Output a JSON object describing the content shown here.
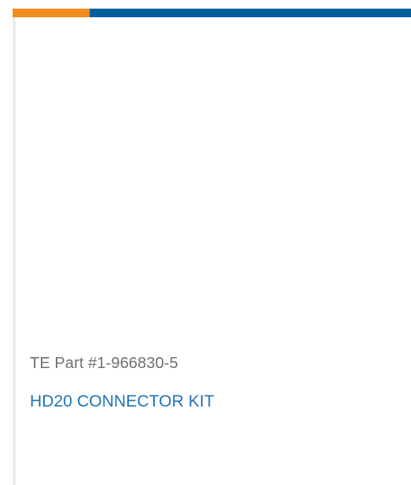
{
  "product": {
    "part_number": "TE Part #1-966830-5",
    "title": "HD20 CONNECTOR KIT"
  },
  "colors": {
    "accent_orange": "#f28c1e",
    "accent_blue": "#00609c",
    "title_link": "#1f72b8",
    "part_text": "#707070",
    "left_rule": "#ededed"
  }
}
